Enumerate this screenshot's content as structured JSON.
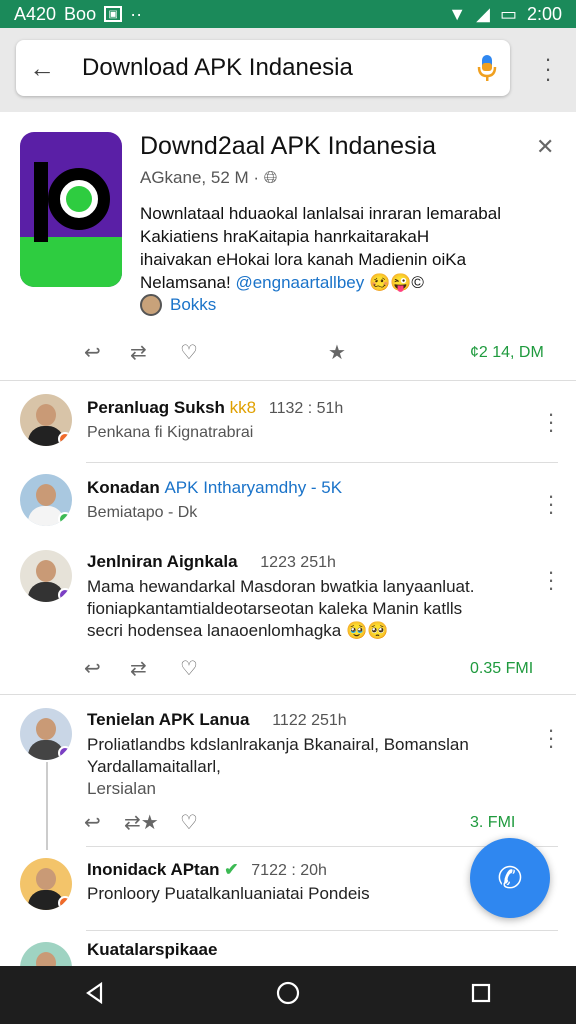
{
  "status_bar": {
    "left_text": "A420",
    "carrier": "Boo",
    "time": "2:00"
  },
  "search": {
    "query": "Download APK Indanesia"
  },
  "app_card": {
    "title": "Downd2aal APK Indanesia",
    "meta": "AGkane, 52 M ·",
    "desc_1": "Nownlataal hduaokal lanlalsai inraran lemarabal",
    "desc_2": "Kakiatiens hraKaitapia hanrkaitarakaH",
    "desc_3": "ihaivakan eHokai lora kanah Madienin oiKa",
    "desc_4_text": "Nelamsana!",
    "desc_4_link": "@engnaartallbey",
    "desc_4_emoji": "🥴😜©",
    "author_label": "Bokks",
    "stat": "¢2 14, DM"
  },
  "tweets": [
    {
      "name": "Peranluag Suksh",
      "highlight": "kk8",
      "time": "1132 : 51h",
      "text": "Penkana fi Kignatrabrai"
    },
    {
      "name": "Konadan",
      "highlight": "APK Intharyamdhy - 5K",
      "time": "",
      "text": "Bemiatapo - Dk"
    },
    {
      "name": "Jenlniran Aignkala",
      "highlight": "",
      "time": "1223 251h",
      "text_1": "Mama hewandarkal Masdoran bwatkia lanyaanluat.",
      "text_2": "fioniapkantamtialdeotarseotan kaleka Manin katlls",
      "text_3": "secri hodensea lanaoenlomhagka 🥹🥺",
      "stat": "0.35 FMI"
    },
    {
      "name": "Tenielan APK Lanua",
      "highlight": "",
      "time": "1122 251h",
      "text_1": "Proliatlandbs kdslanlrakanja Bkanairal, Bomanslan",
      "text_2": "Yardallamaitallarl,",
      "text_3": "Lersialan",
      "stat": "3. FMI"
    },
    {
      "name": "Inonidack APtan",
      "highlight": "",
      "time": "7122 : 20h",
      "text": "Pronloory Puatalkanluaniatai Pondeis"
    },
    {
      "name": "Kuatalarspikaae",
      "highlight": "",
      "time": "",
      "text": ""
    }
  ]
}
